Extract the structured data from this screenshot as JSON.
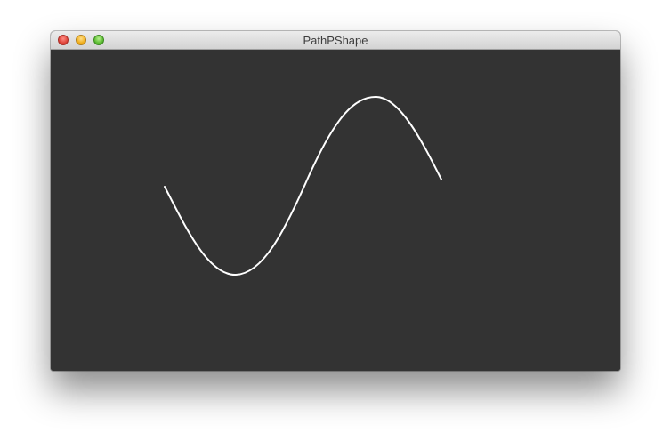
{
  "window": {
    "title": "PathPShape",
    "background_color": "#333333",
    "stroke_color": "#ffffff",
    "controls": [
      "close-button",
      "minimize-button",
      "zoom-button"
    ]
  }
}
